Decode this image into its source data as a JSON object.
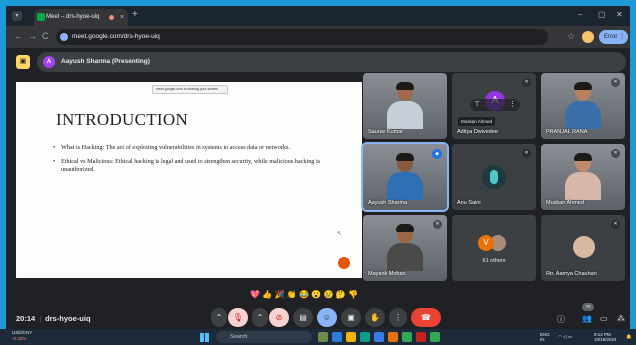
{
  "browser": {
    "tab_title": "Meet – drs-hyoe-uiq",
    "tab_close": "×",
    "new_tab": "+",
    "url": "meet.google.com/drs-hyoe-uiq",
    "error_button": "Error",
    "window_controls": [
      "–",
      "▢",
      "✕"
    ],
    "nav": [
      "←",
      "→",
      "C"
    ]
  },
  "presenting": {
    "avatar_letter": "A",
    "label": "Aayush Sharma (Presenting)"
  },
  "slide": {
    "share_bar": "meet.google.com is sharing your screen",
    "title": "INTRODUCTION",
    "bullets": [
      "What is Hacking: The act of exploiting vulnerabilities in systems to access data or networks.",
      "Ethical vs Malicious: Ethical hacking is legal and used to strengthen security, while malicious hacking is unauthorized."
    ]
  },
  "participants": [
    {
      "name": "Saurav Kumar",
      "type": "video",
      "skin": "#a06b4a",
      "shirt": "#c6cfd8"
    },
    {
      "name": "Aditya Dwivedee",
      "type": "avatar",
      "letter": "A",
      "tooltip": "Muskan Ahmed"
    },
    {
      "name": "PRANJAL RANA",
      "type": "video",
      "skin": "#b88260",
      "shirt": "#3b6fa8"
    },
    {
      "name": "Aayush Sharma",
      "type": "video",
      "skin": "#8a5a3c",
      "shirt": "#2f6fb3",
      "active": true
    },
    {
      "name": "Anu Saini",
      "type": "wave"
    },
    {
      "name": "Muskan Ahmed",
      "type": "video",
      "skin": "#c08a6a",
      "shirt": "#d6b7a8"
    },
    {
      "name": "Mayank Mohan",
      "type": "video",
      "skin": "#9a6645",
      "shirt": "#4a4a4a"
    },
    {
      "name": "61 others",
      "type": "others",
      "letter": "V"
    },
    {
      "name": "Rtr. Aamya Chauhan",
      "type": "avatar-photo"
    }
  ],
  "reactions": [
    "💖",
    "👍",
    "🎉",
    "👏",
    "😂",
    "😮",
    "😢",
    "🤔",
    "👎"
  ],
  "meeting": {
    "time": "20:14",
    "code": "drs-hyoe-uiq",
    "participant_count": "70"
  },
  "taskbar": {
    "ticker": "USD/CNY",
    "ticker_change": "-0.33%",
    "search": "Search",
    "lang": "ENG",
    "region": "IN",
    "time": "8:14 PM",
    "date": "10/18/2024"
  }
}
